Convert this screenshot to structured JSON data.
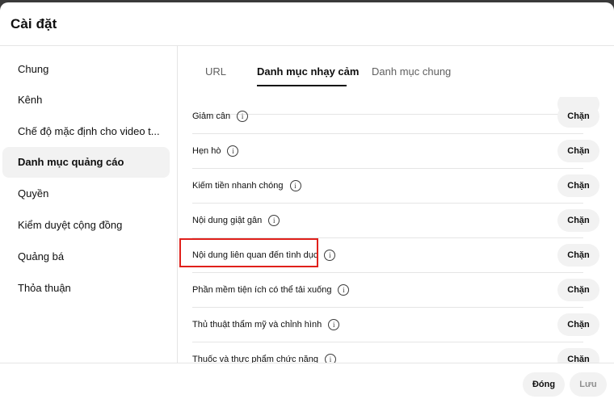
{
  "dialog": {
    "title": "Cài đặt"
  },
  "sidebar": {
    "items": [
      {
        "label": "Chung"
      },
      {
        "label": "Kênh"
      },
      {
        "label": "Chế độ mặc định cho video t..."
      },
      {
        "label": "Danh mục quảng cáo",
        "active": true
      },
      {
        "label": "Quyền"
      },
      {
        "label": "Kiểm duyệt cộng đồng"
      },
      {
        "label": "Quảng bá"
      },
      {
        "label": "Thỏa thuận"
      }
    ]
  },
  "tabs": [
    {
      "label": "URL"
    },
    {
      "label": "Danh mục nhạy cảm",
      "active": true
    },
    {
      "label": "Danh mục chung"
    }
  ],
  "categories": {
    "info_icon_glyph": "i",
    "rows": [
      {
        "label": "Giảm cân",
        "button": "Chặn"
      },
      {
        "label": "Hẹn hò",
        "button": "Chặn"
      },
      {
        "label": "Kiếm tiền nhanh chóng",
        "button": "Chặn"
      },
      {
        "label": "Nội dung giật gân",
        "button": "Chặn"
      },
      {
        "label": "Nội dung liên quan đến tình dục",
        "button": "Chặn",
        "highlighted": true
      },
      {
        "label": "Phần mềm tiện ích có thể tải xuống",
        "button": "Chặn"
      },
      {
        "label": "Thủ thuật thẩm mỹ và chỉnh hình",
        "button": "Chặn"
      },
      {
        "label": "Thuốc và thực phẩm chức năng",
        "button": "Chặn"
      }
    ]
  },
  "footer": {
    "close_label": "Đóng",
    "save_label": "Lưu"
  },
  "colors": {
    "highlight": "#e0201b",
    "pill_bg": "#f2f2f2",
    "disabled_text": "#909090"
  }
}
